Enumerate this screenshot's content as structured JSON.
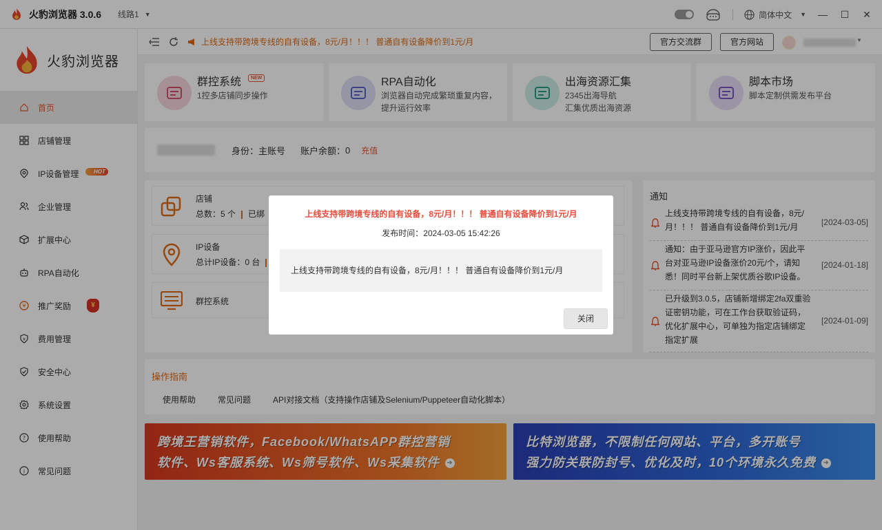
{
  "app": {
    "title": "火豹浏览器 3.0.6",
    "route": "线路1",
    "language": "简体中文",
    "brand_name": "火豹浏览器"
  },
  "colors": {
    "accent": "#e4572e",
    "announce": "#e06a14",
    "dialog_title": "#e84c3d"
  },
  "sidebar": {
    "items": [
      {
        "label": "首页",
        "icon": "home-icon"
      },
      {
        "label": "店铺管理",
        "icon": "grid-icon"
      },
      {
        "label": "IP设备管理",
        "icon": "location-pin-icon",
        "badge": "HOT"
      },
      {
        "label": "企业管理",
        "icon": "users-icon"
      },
      {
        "label": "扩展中心",
        "icon": "cube-icon"
      },
      {
        "label": "RPA自动化",
        "icon": "robot-icon"
      },
      {
        "label": "推广奖励",
        "icon": "coin-icon",
        "badge_icon": "money-bag-icon"
      },
      {
        "label": "费用管理",
        "icon": "shield-yen-icon"
      },
      {
        "label": "安全中心",
        "icon": "shield-check-icon"
      },
      {
        "label": "系统设置",
        "icon": "gear-icon"
      },
      {
        "label": "使用帮助",
        "icon": "question-icon"
      },
      {
        "label": "常见问题",
        "icon": "info-icon"
      }
    ]
  },
  "topbar": {
    "announcement": "上线支持带跨境专线的自有设备，8元/月！！！ 普通自有设备降价到1元/月",
    "btn_group": "官方交流群",
    "btn_site": "官方网站"
  },
  "cards": [
    {
      "title": "群控系统",
      "desc": "1控多店铺同步操作",
      "badge": "NEW",
      "icon": "group-control-icon"
    },
    {
      "title": "RPA自动化",
      "desc": "浏览器自动完成繁琐重复内容，提升运行效率",
      "icon": "rpa-icon"
    },
    {
      "title": "出海资源汇集",
      "desc": "2345出海导航\n汇集优质出海资源",
      "icon": "globe-plane-icon"
    },
    {
      "title": "脚本市场",
      "desc": "脚本定制供需发布平台",
      "icon": "code-icon"
    }
  ],
  "account": {
    "identity": "身份：主账号",
    "balance_label": "账户余额：",
    "balance": "0",
    "recharge": "充值"
  },
  "stats": [
    {
      "title": "店铺",
      "sub": "总数：5 个",
      "sub2": "已绑",
      "icon": "shop-icon"
    },
    {
      "title": "IP设备",
      "sub": "总计IP设备：0 台",
      "icon": "location-pin-icon"
    },
    {
      "title": "群控系统",
      "icon": "monitor-icon"
    }
  ],
  "notice": {
    "header": "通知",
    "items": [
      {
        "text": "上线支持带跨境专线的自有设备，8元/月！！！ 普通自有设备降价到1元/月",
        "date": "[2024-03-05]"
      },
      {
        "text": "通知：由于亚马逊官方IP涨价，因此平台对亚马逊IP设备涨价20元/个，请知悉！同时平台新上架优质谷歌IP设备。",
        "date": "[2024-01-18]"
      },
      {
        "text": "已升级到3.0.5，店铺新增绑定2fa双重验证密钥功能，可在工作台获取验证码，优化扩展中心，可单独为指定店铺绑定指定扩展",
        "date": "[2024-01-09]"
      }
    ]
  },
  "guide": {
    "title": "操作指南",
    "links": [
      "使用帮助",
      "常见问题",
      "API对接文档（支持操作店铺及Selenium/Puppeteer自动化脚本）"
    ]
  },
  "banners": [
    {
      "line1": "跨境王营销软件，Facebook/WhatsAPP群控营销",
      "line2": "软件、Ws客服系统、Ws筛号软件、Ws采集软件"
    },
    {
      "line1": "比特浏览器，不限制任何网站、平台，多开账号",
      "line2": "强力防关联防封号、优化及时，10个环境永久免费"
    }
  ],
  "dialog": {
    "title": "上线支持带跨境专线的自有设备，8元/月！！！ 普通自有设备降价到1元/月",
    "time": "发布时间：2024-03-05 15:42:26",
    "body": "上线支持带跨境专线的自有设备，8元/月！！！ 普通自有设备降价到1元/月",
    "close": "关闭"
  }
}
